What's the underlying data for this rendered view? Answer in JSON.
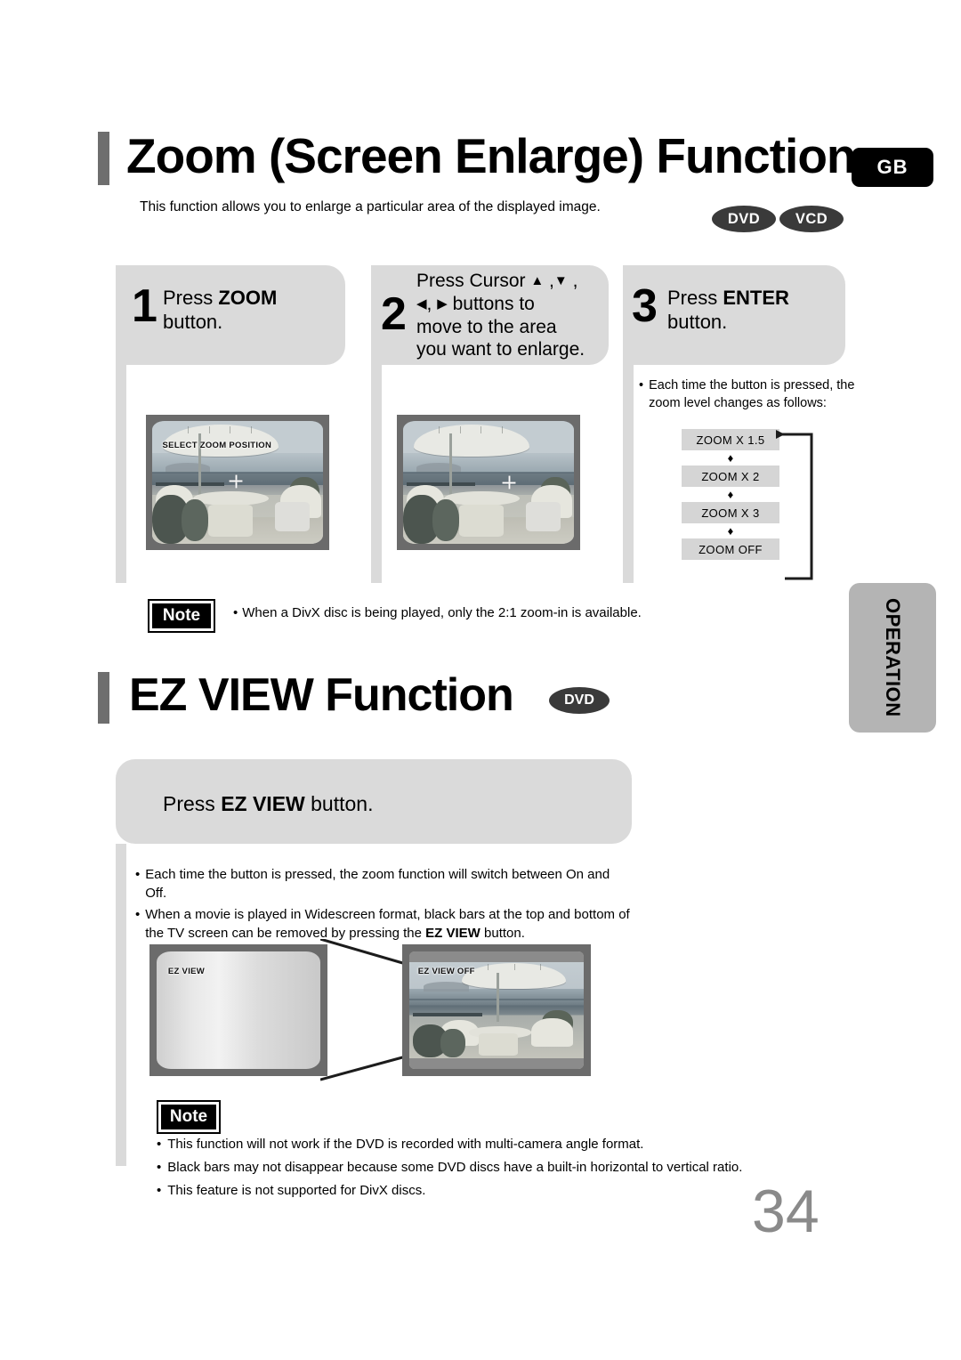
{
  "section_zoom": {
    "title": "Zoom (Screen Enlarge) Function",
    "region_badge": "GB",
    "subtitle": "This function allows you to enlarge a particular area of the displayed image.",
    "disc_badges": [
      "DVD",
      "VCD"
    ],
    "steps": [
      {
        "number": "1",
        "text_html": "Press <b>ZOOM</b><br>button.",
        "text_plain": "Press ZOOM button."
      },
      {
        "number": "2",
        "text_html": "Press Cursor <span class=\"arrow-glyph\">▲</span> ,<span class=\"arrow-glyph\">▼</span> ,<br><span class=\"arrow-glyph\">◀</span>, <span class=\"arrow-glyph\">▶</span> buttons to<br>move to the area<br>you want to enlarge.",
        "text_plain": "Press Cursor ▲,▼,◀,▶ buttons to move to the area you want to enlarge."
      },
      {
        "number": "3",
        "text_html": "Press <b>ENTER</b><br>button.",
        "text_plain": "Press ENTER button."
      }
    ],
    "step3_note": "Each time the button is pressed, the zoom level changes as follows:",
    "zoom_flow": {
      "steps": [
        "ZOOM X 1.5",
        "ZOOM X 2",
        "ZOOM X 3",
        "ZOOM OFF"
      ],
      "arrow_glyph": "♦",
      "loops_back": true
    },
    "tv_screens": [
      {
        "osd": "SELECT ZOOM POSITION",
        "has_crosshair": true
      },
      {
        "osd": "",
        "has_crosshair": true
      }
    ],
    "note": {
      "label": "Note",
      "items": [
        "When a DivX disc is being played, only the 2:1 zoom-in is available."
      ]
    }
  },
  "section_ezview": {
    "title": "EZ VIEW Function",
    "disc_badge": "DVD",
    "panel_text_html": "Press <b>EZ VIEW</b> button.",
    "panel_text_plain": "Press EZ VIEW button.",
    "bullets": [
      "Each time the button is pressed, the zoom function will switch between On and Off.",
      "When a movie is played in Widescreen format, black bars at the top and bottom of the TV screen can be removed by pressing the EZ VIEW button."
    ],
    "bullet_html": [
      "Each time the button is pressed, the zoom function will switch between On and Off.",
      "When a movie is played in Widescreen format, black bars at the top and bottom of the TV screen can be removed by pressing the <b>EZ VIEW</b> button."
    ],
    "tv_screens": [
      {
        "osd": "EZ VIEW"
      },
      {
        "osd": "EZ VIEW OFF"
      }
    ],
    "note": {
      "label": "Note",
      "items": [
        "This function will not work if the DVD is recorded with multi-camera angle format.",
        "Black bars may not disappear because some DVD discs have a built-in horizontal to vertical ratio.",
        "This feature is not supported for DivX discs."
      ]
    }
  },
  "sidebar": {
    "tab_label": "OPERATION"
  },
  "footer": {
    "page_number": "34"
  },
  "colors": {
    "panel_gray": "#dadada",
    "accent_bar_gray": "#6e6e6e",
    "tab_gray": "#b4b4b4",
    "flow_box_gray": "#d5d5d5",
    "badge_black": "#000000",
    "disc_badge_gray": "#3a3a3a",
    "page_number_gray": "#8a8a8a"
  },
  "bullet_char": "•"
}
